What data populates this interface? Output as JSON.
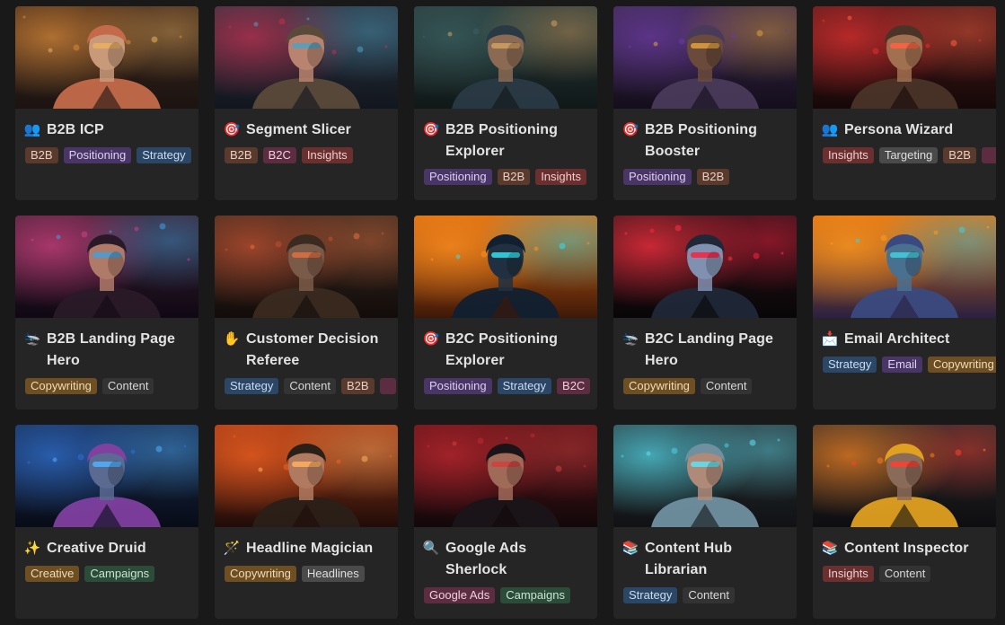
{
  "cards": [
    {
      "title": "B2B ICP",
      "icon": "busts-icon",
      "emoji": "👥",
      "tags": [
        [
          "B2B",
          "brown"
        ],
        [
          "Positioning",
          "purple"
        ],
        [
          "Strategy",
          "blue"
        ]
      ]
    },
    {
      "title": "Segment Slicer",
      "icon": "target-icon",
      "emoji": "🎯",
      "tags": [
        [
          "B2B",
          "brown"
        ],
        [
          "B2C",
          "pink"
        ],
        [
          "Insights",
          "red"
        ]
      ]
    },
    {
      "title": "B2B Positioning Explorer",
      "icon": "target-icon",
      "emoji": "🎯",
      "tags": [
        [
          "Positioning",
          "purple"
        ],
        [
          "B2B",
          "brown"
        ],
        [
          "Insights",
          "red"
        ]
      ]
    },
    {
      "title": "B2B Positioning Booster",
      "icon": "target-icon",
      "emoji": "🎯",
      "tags": [
        [
          "Positioning",
          "purple"
        ],
        [
          "B2B",
          "brown"
        ]
      ]
    },
    {
      "title": "Persona Wizard",
      "icon": "busts-icon",
      "emoji": "👥",
      "tags": [
        [
          "Insights",
          "red"
        ],
        [
          "Targeting",
          "gray"
        ],
        [
          "B2B",
          "brown"
        ],
        [
          "",
          "pink"
        ]
      ]
    },
    {
      "title": "B2B Landing Page Hero",
      "icon": "airplane-icon",
      "emoji": "🛬",
      "tags": [
        [
          "Copywriting",
          "orange"
        ],
        [
          "Content",
          "dark"
        ]
      ]
    },
    {
      "title": "Customer Decision Referee",
      "icon": "raised-hand-icon",
      "emoji": "✋",
      "tags": [
        [
          "Strategy",
          "blue"
        ],
        [
          "Content",
          "dark"
        ],
        [
          "B2B",
          "brown"
        ],
        [
          "",
          "pink"
        ]
      ]
    },
    {
      "title": "B2C Positioning Explorer",
      "icon": "target-icon",
      "emoji": "🎯",
      "tags": [
        [
          "Positioning",
          "purple"
        ],
        [
          "Strategy",
          "blue"
        ],
        [
          "B2C",
          "pink"
        ]
      ]
    },
    {
      "title": "B2C Landing Page Hero",
      "icon": "airplane-icon",
      "emoji": "🛬",
      "tags": [
        [
          "Copywriting",
          "orange"
        ],
        [
          "Content",
          "dark"
        ]
      ]
    },
    {
      "title": "Email Architect",
      "icon": "inbox-icon",
      "emoji": "📩",
      "tags": [
        [
          "Strategy",
          "blue"
        ],
        [
          "Email",
          "purple"
        ],
        [
          "Copywriting",
          "orange"
        ]
      ]
    },
    {
      "title": "Creative Druid",
      "icon": "sparkles-icon",
      "emoji": "✨",
      "tags": [
        [
          "Creative",
          "orange"
        ],
        [
          "Campaigns",
          "green"
        ]
      ]
    },
    {
      "title": "Headline Magician",
      "icon": "magic-wand-icon",
      "emoji": "🪄",
      "tags": [
        [
          "Copywriting",
          "orange"
        ],
        [
          "Headlines",
          "gray"
        ]
      ]
    },
    {
      "title": "Google Ads Sherlock",
      "icon": "magnifier-icon",
      "emoji": "🔍",
      "tags": [
        [
          "Google Ads",
          "pink"
        ],
        [
          "Campaigns",
          "green"
        ]
      ]
    },
    {
      "title": "Content Hub Librarian",
      "icon": "books-icon",
      "emoji": "📚",
      "tags": [
        [
          "Strategy",
          "blue"
        ],
        [
          "Content",
          "dark"
        ]
      ]
    },
    {
      "title": "Content Inspector",
      "icon": "books-icon",
      "emoji": "📚",
      "tags": [
        [
          "Insights",
          "red"
        ],
        [
          "Content",
          "dark"
        ]
      ]
    }
  ],
  "covers": [
    {
      "bg": [
        "#3a2418",
        "#1c1412"
      ],
      "glow": "#d8893a",
      "face": "#c99a7a",
      "hair": "#c46a4a",
      "accent": "#e8b060"
    },
    {
      "bg": [
        "#2a3440",
        "#12161e"
      ],
      "glow": "#c03050",
      "face": "#b88470",
      "hair": "#5a4a3a",
      "accent": "#50a0c0"
    },
    {
      "bg": [
        "#2a3a3a",
        "#101818"
      ],
      "glow": "#3a6060",
      "face": "#8a6a52",
      "hair": "#2a3a44",
      "accent": "#d0a060"
    },
    {
      "bg": [
        "#3a2a4a",
        "#140e1c"
      ],
      "glow": "#6a3aa0",
      "face": "#6a4a3a",
      "hair": "#4a3a5a",
      "accent": "#e0a040"
    },
    {
      "bg": [
        "#4a1a1a",
        "#160808"
      ],
      "glow": "#e03030",
      "face": "#a07050",
      "hair": "#4a3428",
      "accent": "#ff6040"
    },
    {
      "bg": [
        "#3a2030",
        "#100814"
      ],
      "glow": "#d04080",
      "face": "#b07a68",
      "hair": "#2a1a28",
      "accent": "#40a0e0"
    },
    {
      "bg": [
        "#3a2a20",
        "#120c0a"
      ],
      "glow": "#c05030",
      "face": "#7a5a48",
      "hair": "#3a2a20",
      "accent": "#e07040"
    },
    {
      "bg": [
        "#d86a10",
        "#401808"
      ],
      "glow": "#ff9020",
      "face": "#203040",
      "hair": "#102030",
      "accent": "#30e0f0"
    },
    {
      "bg": [
        "#2a1418",
        "#080608"
      ],
      "glow": "#ff3040",
      "face": "#8090b0",
      "hair": "#202838",
      "accent": "#ff2040"
    },
    {
      "bg": [
        "#e07010",
        "#2a2040"
      ],
      "glow": "#ff9a20",
      "face": "#4a7090",
      "hair": "#3a4a80",
      "accent": "#40d0e0"
    },
    {
      "bg": [
        "#182a4a",
        "#080c18"
      ],
      "glow": "#3070d0",
      "face": "#5a6a90",
      "hair": "#8040a0",
      "accent": "#50b0ff"
    },
    {
      "bg": [
        "#a03a18",
        "#200c08"
      ],
      "glow": "#f06020",
      "face": "#b07a60",
      "hair": "#2a2018",
      "accent": "#ffb060"
    },
    {
      "bg": [
        "#5a1418",
        "#12080a"
      ],
      "glow": "#c02830",
      "face": "#a06a58",
      "hair": "#1a1418",
      "accent": "#d04040"
    },
    {
      "bg": [
        "#2a3034",
        "#101214"
      ],
      "glow": "#50d0e0",
      "face": "#b08a78",
      "hair": "#7090a0",
      "accent": "#60e0f0"
    },
    {
      "bg": [
        "#2a2a2c",
        "#0e0e10"
      ],
      "glow": "#f08020",
      "face": "#8a6a58",
      "hair": "#e0a020",
      "accent": "#ff4030"
    }
  ]
}
